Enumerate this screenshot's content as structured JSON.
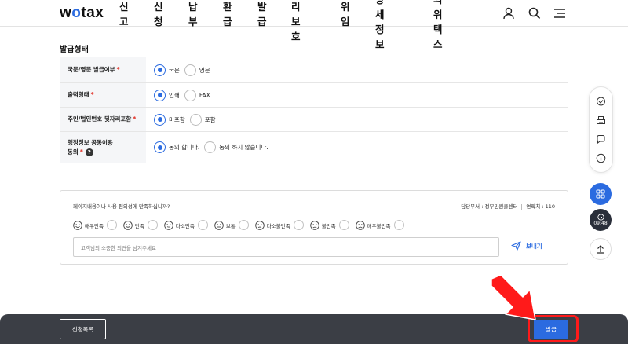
{
  "header": {
    "logo_prefix": "w",
    "logo_o": "o",
    "logo_suffix": "tax",
    "nav": [
      "신고",
      "신청",
      "납부",
      "환급",
      "발급",
      "권리보호",
      "위임",
      "지방세정보",
      "나의위택스"
    ],
    "icons": [
      "user-icon",
      "search-icon",
      "menu-icon"
    ]
  },
  "section": {
    "title": "발급형태",
    "rows": [
      {
        "label": "국문/영문 발급여부",
        "required": "*",
        "options": [
          "국문",
          "영문"
        ],
        "selected": 0
      },
      {
        "label": "출력형태",
        "required": "*",
        "options": [
          "인쇄",
          "FAX"
        ],
        "selected": 0
      },
      {
        "label": "주민/법인번호 뒷자리포함",
        "required": "*",
        "options": [
          "미포함",
          "포함"
        ],
        "selected": 0
      },
      {
        "label_line1": "행정정보 공동이용",
        "label_line2": "동의",
        "required": "*",
        "options": [
          "동의 합니다.",
          "동의 하지 않습니다."
        ],
        "selected": 0
      }
    ]
  },
  "survey": {
    "question": "페이지내용이나 사용 편의성에 만족하십니까?",
    "dept": "담당부서 : 정부민원콜센터",
    "contact": "연락처 : 110",
    "ratings": [
      "매우만족",
      "만족",
      "다소만족",
      "보통",
      "다소불만족",
      "불만족",
      "매우불만족"
    ],
    "comment_placeholder": "고객님의 소중한 의견을 남겨주세요",
    "send_label": "보내기"
  },
  "float_menu": {
    "icons": [
      "chat-icon",
      "print-icon",
      "help-chat-icon",
      "info-icon"
    ],
    "timer": "09:48"
  },
  "bottom": {
    "list_label": "신청목록",
    "issue_label": "발급"
  },
  "colors": {
    "accent": "#2b6be0",
    "bottom_bar": "#3b3e45",
    "highlight": "#ff1a1a"
  }
}
